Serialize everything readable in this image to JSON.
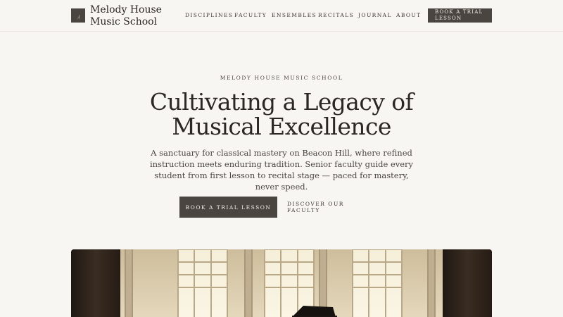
{
  "brand": {
    "name": "Melody House Music School",
    "logo_icon": "piano-icon"
  },
  "nav": {
    "items": [
      {
        "label": "DISCIPLINES"
      },
      {
        "label": "FACULTY"
      },
      {
        "label": "ENSEMBLES"
      },
      {
        "label": "RECITALS"
      },
      {
        "label": "JOURNAL"
      },
      {
        "label": "ABOUT"
      }
    ],
    "cta_label": "BOOK A TRIAL LESSON"
  },
  "hero": {
    "eyebrow": "MELODY HOUSE MUSIC SCHOOL",
    "headline": "Cultivating a Legacy of Musical Excellence",
    "subtitle": "A sanctuary for classical mastery on Beacon Hill, where refined instruction meets enduring tradition. Senior faculty guide every student from first lesson to recital stage — paced for mastery, never speed.",
    "primary_button": "BOOK A TRIAL LESSON",
    "secondary_button": "DISCOVER OUR FACULTY"
  },
  "colors": {
    "background": "#f8f6f2",
    "accent": "#4a4540",
    "text": "#2b2724"
  }
}
